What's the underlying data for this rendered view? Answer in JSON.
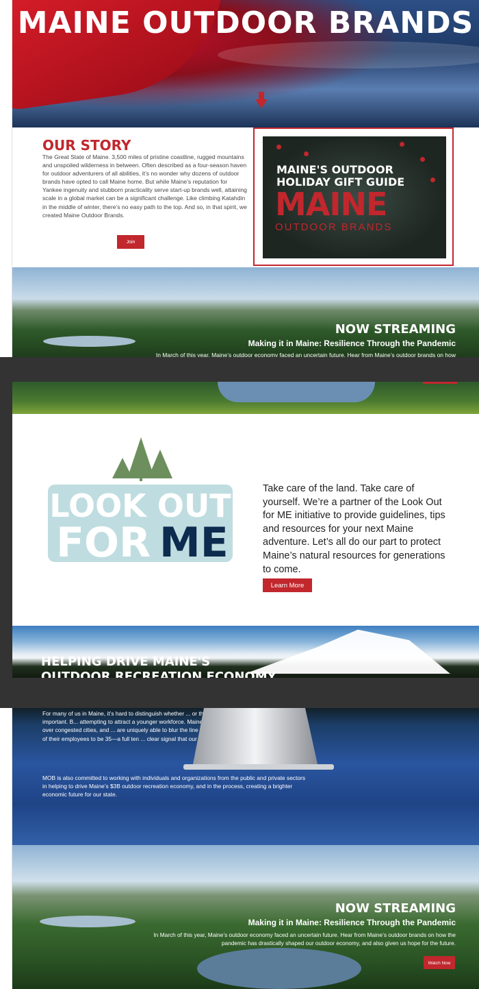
{
  "hero": {
    "title": "MAINE OUTDOOR BRANDS"
  },
  "story": {
    "title": "OUR STORY",
    "body": "The Great State of Maine. 3,500 miles of pristine coastline, rugged mountains and unspoiled wilderness in between. Often described as a four-season haven for outdoor adventurers of all abilities, it’s no wonder why dozens of outdoor brands have opted to call Maine home. But while Maine’s reputation for Yankee ingenuity and stubborn practicality serve start-up brands well, attaining scale in a global market can be a significant challenge. Like climbing Katahdin in the middle of winter, there’s no easy path to the top. And so, in that spirit, we created Maine Outdoor Brands.",
    "button": "Join Now"
  },
  "gift_guide": {
    "line1": "MAINE'S OUTDOOR",
    "line2": "HOLIDAY GIFT GUIDE",
    "brand": "MAINE",
    "sub": "OUTDOOR BRANDS"
  },
  "streaming_top": {
    "title": "NOW STREAMING",
    "subtitle": "Making it in Maine: Resilience Through the Pandemic",
    "desc": "In March of this year, Maine’s outdoor economy faced an uncertain future. Hear from Maine’s outdoor brands on how"
  },
  "lookout": {
    "logo_line1": "LOOK OUT",
    "logo_for": "FOR",
    "logo_me": "ME",
    "text": "Take care of the land. Take care of yourself. We’re a partner of the Look Out for ME initiative to provide guidelines, tips and resources for your next Maine adventure. Let’s all do our part to protect Maine’s natural resources for generations to come.",
    "button": "Learn More"
  },
  "helping": {
    "title_line1": "HELPING DRIVE MAINE'S",
    "title_line2": "OUTDOOR RECREATION ECONOMY"
  },
  "economy": {
    "p1": "For many of us in Maine, it’s hard to distinguish whether ... or those pursuits propel our passion. That’s important. B... attempting to attract a younger workforce. Maine’s outdo... particular value quality of life over congested cities, and ... are uniquely able to blur the line between work and play. ... the average age of their employees to be 35—a full ten ... clear signal that our industry is leading Maine in the rig...",
    "p2": "MOB is also committed to working with individuals and organizations from the public and private sectors in helping to drive Maine’s $3B outdoor recreation economy, and in the process, creating a brighter economic future for our state."
  },
  "streaming_bottom": {
    "title": "NOW STREAMING",
    "subtitle": "Making it in Maine: Resilience Through the Pandemic",
    "desc": "In March of this year, Maine’s outdoor economy faced an uncertain future. Hear from Maine’s outdoor brands on how the pandemic has drastically shaped our outdoor economy, and also given us hope for the future.",
    "button": "Watch Now"
  },
  "colors": {
    "brand_red": "#c1272d",
    "navy": "#0d2b4e",
    "lofm_blue": "#bfdde0",
    "tree_green": "#6d8f5e"
  }
}
